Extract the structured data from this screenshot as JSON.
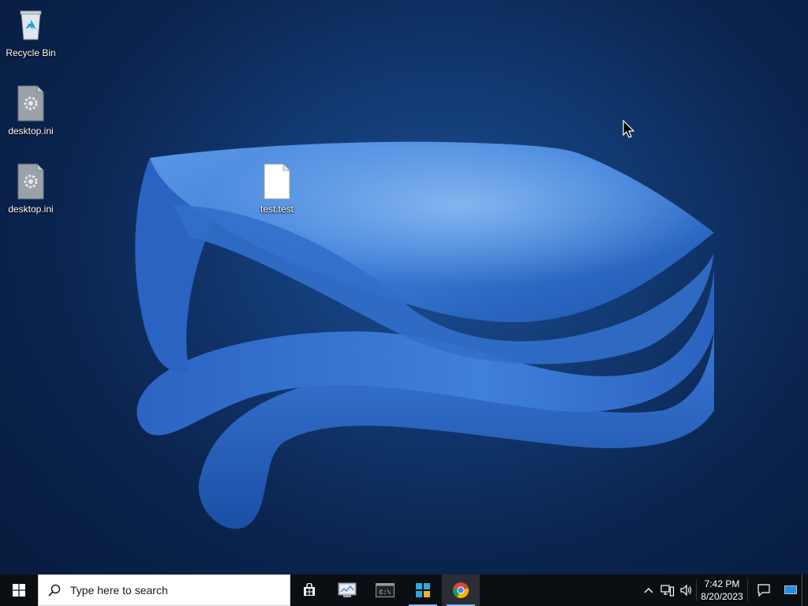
{
  "desktop": {
    "icons": [
      {
        "label": "Recycle Bin",
        "icon": "recycle-bin-icon"
      },
      {
        "label": "desktop.ini",
        "icon": "settings-file-icon"
      },
      {
        "label": "desktop.ini",
        "icon": "settings-file-icon"
      },
      {
        "label": "test.test",
        "icon": "blank-file-icon"
      }
    ]
  },
  "taskbar": {
    "start_icon": "windows-logo-icon",
    "search_placeholder": "Type here to search",
    "pinned": [
      {
        "name": "microsoft-store-icon"
      },
      {
        "name": "control-panel-icon"
      },
      {
        "name": "command-prompt-icon",
        "text": "C:\\"
      },
      {
        "name": "windows-app-icon"
      },
      {
        "name": "chrome-icon"
      }
    ],
    "tray": {
      "time": "7:42 PM",
      "date": "8/20/2023"
    }
  },
  "colors": {
    "wallpaper_accent": "#2d6fd0",
    "taskbar_bg": "#0b0e12",
    "chrome_running_indicator": "#8ab4f8"
  }
}
